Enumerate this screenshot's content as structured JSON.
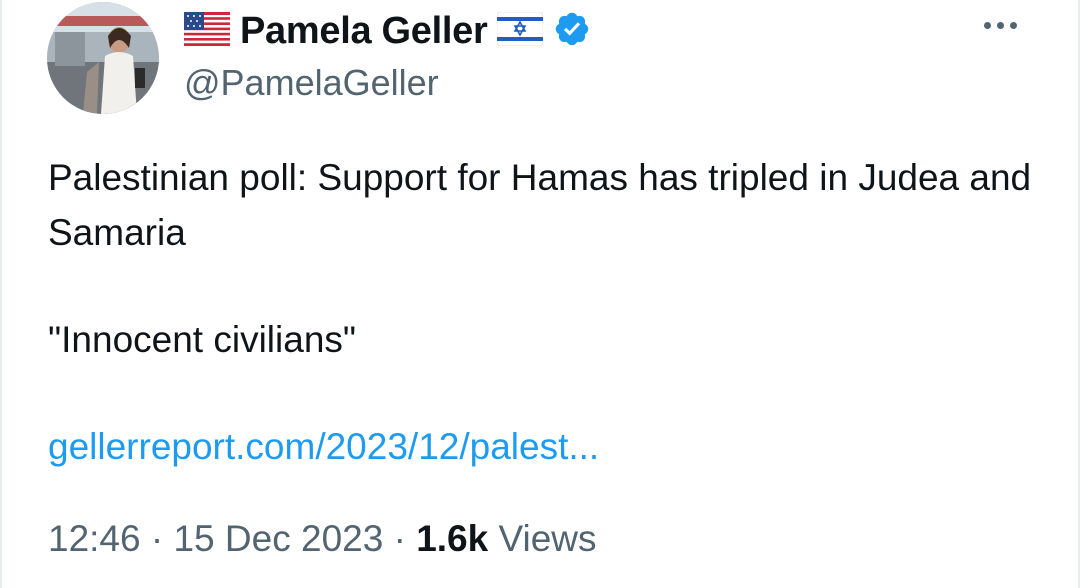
{
  "author": {
    "display_name": "Pamela Geller",
    "handle": "@PamelaGeller",
    "verified": true,
    "prefix_flag": "us-flag-emoji",
    "suffix_flag": "israel-flag-emoji"
  },
  "tweet": {
    "line1": "Palestinian poll: Support for Hamas has tripled in Judea and Samaria",
    "line2": "\"Innocent civilians\"",
    "link_text": "gellerreport.com/2023/12/palest..."
  },
  "meta": {
    "time": "12:46",
    "sep1": " · ",
    "date": "15 Dec 2023",
    "sep2": " · ",
    "views_count": "1.6k",
    "views_label": " Views"
  },
  "colors": {
    "link": "#1d9bf0",
    "verified_badge": "#1d9bf0",
    "secondary_text": "#536471",
    "primary_text": "#0f1419"
  },
  "icons": [
    "more-icon",
    "verified-badge-icon"
  ]
}
